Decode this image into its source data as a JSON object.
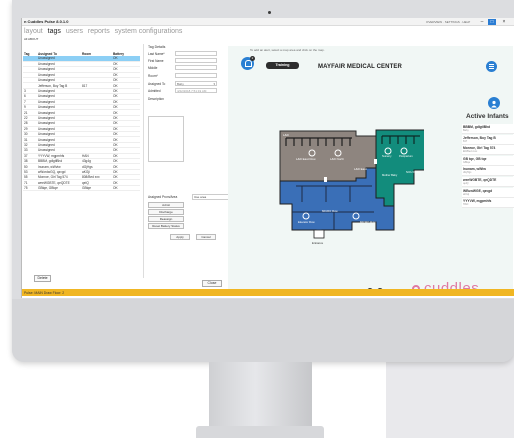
{
  "app": {
    "title": "n Cuddles Pulse 8.0.1.0",
    "top_links": "OVERVIEW · SETTINGS · HELP",
    "window_buttons": [
      "–",
      "□",
      "×"
    ]
  },
  "menu": {
    "items": [
      "layout",
      "tags",
      "users",
      "reports",
      "system configurations"
    ],
    "active": "tags",
    "sub_label": "All ABOUT"
  },
  "table": {
    "headers": [
      "Tag",
      "Assigned To",
      "Room",
      "Battery"
    ],
    "rows": [
      [
        "",
        "Unassigned",
        "",
        "OK"
      ],
      [
        "",
        "Unassigned",
        "",
        "OK"
      ],
      [
        "",
        "Unassigned",
        "",
        "OK"
      ],
      [
        "",
        "Unassigned",
        "",
        "OK"
      ],
      [
        "",
        "Unassigned",
        "",
        "OK"
      ],
      [
        "",
        "Jefferson, Boy Tag B",
        "817",
        "OK"
      ],
      [
        "3",
        "Unassigned",
        "",
        "OK"
      ],
      [
        "6",
        "Unassigned",
        "",
        "OK"
      ],
      [
        "7",
        "Unassigned",
        "",
        "OK"
      ],
      [
        "9",
        "Unassigned",
        "",
        "OK"
      ],
      [
        "21",
        "Unassigned",
        "",
        "OK"
      ],
      [
        "22",
        "Unassigned",
        "",
        "OK"
      ],
      [
        "28",
        "Unassigned",
        "",
        "OK"
      ],
      [
        "29",
        "Unassigned",
        "",
        "OK"
      ],
      [
        "30",
        "Unassigned",
        "",
        "OK"
      ],
      [
        "31",
        "Unassigned",
        "",
        "OK"
      ],
      [
        "32",
        "Unassigned",
        "",
        "OK"
      ],
      [
        "33",
        "Unassigned",
        "",
        "OK"
      ],
      [
        "37",
        "YYYVW, mgpmhfs",
        "HAN",
        "OK"
      ],
      [
        "38",
        "BBBM, gdlgtlBhd",
        "43g4g",
        "OK"
      ],
      [
        "50",
        "Inunam, wWvtw",
        "dGjHgs",
        "OK"
      ],
      [
        "53",
        "wWordwGQ, qzvgd",
        "aKGji",
        "OK"
      ],
      [
        "55",
        "Monroe, Girl Tag 574",
        "808/Bed xxx",
        "OK"
      ],
      [
        "71",
        "weeWGBTE, qeQDTE",
        "qeIQ",
        "OK"
      ],
      [
        "75",
        "GBtqe, GBtqe",
        "GBtqe",
        "OK"
      ]
    ],
    "selected_row": 0,
    "delete_label": "Delete"
  },
  "details": {
    "title": "Tag Details",
    "fields": [
      {
        "label": "Last Name*",
        "value": ""
      },
      {
        "label": "First Name",
        "value": ""
      },
      {
        "label": "Middle",
        "value": ""
      },
      {
        "label": "Room*",
        "value": ""
      },
      {
        "label": "Assigned To",
        "value": "Baby"
      },
      {
        "label": "Admitted",
        "value": "4/22/2018 7:51:19 AM"
      },
      {
        "label": "Description",
        "value": ""
      }
    ],
    "assigned_to_options": [
      "Baby"
    ],
    "actions": [
      "Admit",
      "Discharge",
      "Reassign",
      "Reset Battery Status"
    ],
    "pform_label": "Assigned Prom/Area",
    "pform_value": "Use area",
    "apply_label": "Apply",
    "cancel_label": "Cancel",
    "close_label": "Close"
  },
  "map": {
    "hint": "To add an alert, select a map area and click on the map.",
    "notification_count": "2",
    "training_label": "Training",
    "center_name": "MAYFAIR MEDICAL CENTER",
    "infants_title": "Active Infants",
    "infants": [
      {
        "name": "BBBM, gdlgtlBhd",
        "sub": "Baby"
      },
      {
        "name": "Jefferson, Boy Tag B",
        "sub": "817"
      },
      {
        "name": "Monroe, Girl Tag 574",
        "sub": "ED/Bed xxxx"
      },
      {
        "name": "GB tqe, GB tqe",
        "sub": "GBtqe"
      },
      {
        "name": "Inunam, wWtw",
        "sub": "dGjHgs"
      },
      {
        "name": "weeWGBTE, qeQDTE",
        "sub": "qeIQ"
      },
      {
        "name": "WEuwWGE, qzvgd",
        "sub": "aKGji"
      },
      {
        "name": "YYYVW, mgpmhfs",
        "sub": "HAN"
      }
    ],
    "floorplan_labels": {
      "ld_1": "L&D",
      "ld_east": "L&D East Row",
      "ld_north": "L&D North",
      "ld_east2": "L&D East",
      "teal_a": "Nursery",
      "teal_b": "Postpartum",
      "teal_c": "NICU Room",
      "blue_a": "Mother Baby",
      "wc_left": "Elevator Row",
      "wc_mid": "MICRO Row",
      "wc_right": "MICRO Row",
      "entrance": "Entrance"
    },
    "pager": [
      "1",
      "2"
    ],
    "logo_text": "cuddles"
  },
  "status": {
    "text": "Pulse: MAIN Draw Floor: 2"
  },
  "colors": {
    "accent": "#2a7fd2",
    "status_bar": "#f0b623",
    "selected_row": "#8ccff5",
    "floor_gray": "#8e857f",
    "floor_teal": "#128c7c",
    "floor_blue": "#3a6fb7",
    "logo_pink": "#e07aa3"
  }
}
